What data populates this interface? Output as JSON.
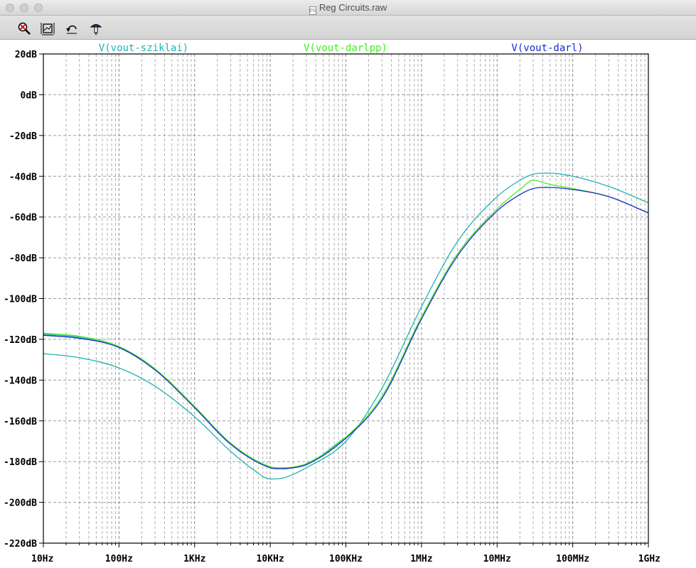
{
  "window": {
    "title": "Reg Circuits.raw",
    "doc_icon_text": "PS"
  },
  "toolbar": {
    "tools": [
      {
        "name": "zoom-tool",
        "icon": "magnifier-x-icon"
      },
      {
        "name": "autorange-tool",
        "icon": "autorange-icon"
      },
      {
        "name": "undo-zoom-tool",
        "icon": "undo-icon"
      },
      {
        "name": "probe-tool",
        "icon": "probe-icon"
      }
    ]
  },
  "chart_data": {
    "type": "line",
    "xscale": "log",
    "xlim": [
      10,
      1000000000
    ],
    "ylim": [
      -220,
      20
    ],
    "yticks": [
      20,
      0,
      -20,
      -40,
      -60,
      -80,
      -100,
      -120,
      -140,
      -160,
      -180,
      -200,
      -220
    ],
    "ytick_labels": [
      "20dB",
      "0dB",
      "-20dB",
      "-40dB",
      "-60dB",
      "-80dB",
      "-100dB",
      "-120dB",
      "-140dB",
      "-160dB",
      "-180dB",
      "-200dB",
      "-220dB"
    ],
    "xticks": [
      10,
      100,
      1000,
      10000,
      100000,
      1000000,
      10000000,
      100000000,
      1000000000
    ],
    "xtick_labels": [
      "10Hz",
      "100Hz",
      "1KHz",
      "10KHz",
      "100KHz",
      "1MHz",
      "10MHz",
      "100MHz",
      "1GHz"
    ],
    "grid": true,
    "series": [
      {
        "name": "V(vout-sziklai)",
        "color": "#22b2b2",
        "x": [
          10,
          30,
          100,
          300,
          1000,
          3000,
          6000,
          10000,
          15000,
          30000,
          100000,
          300000,
          1000000,
          3000000,
          10000000,
          20000000,
          30000000,
          50000000,
          100000000,
          300000000,
          1000000000
        ],
        "y": [
          -127,
          -129,
          -134,
          -143,
          -158,
          -175,
          -184,
          -188.5,
          -188,
          -183,
          -170,
          -144,
          -104,
          -72,
          -50,
          -42,
          -39,
          -38.5,
          -40,
          -45,
          -53
        ]
      },
      {
        "name": "V(vout-sziklai)",
        "color": "#22b2b2",
        "x": [
          10,
          30,
          100,
          300,
          1000,
          3000,
          10000,
          15000,
          20000,
          30000,
          100000
        ],
        "y": [
          -117.5,
          -119,
          -124,
          -135,
          -153,
          -171,
          -182.8,
          -183.2,
          -183,
          -181.5,
          -168
        ]
      },
      {
        "name": "V(vout-darlpp)",
        "color": "#44ee22",
        "x": [
          10,
          30,
          100,
          300,
          1000,
          3000,
          10000,
          15000,
          20000,
          30000,
          100000,
          300000,
          1000000,
          3000000,
          10000000,
          20000000,
          30000000,
          50000000,
          100000000,
          300000000,
          1000000000
        ],
        "y": [
          -117,
          -118.5,
          -123.5,
          -134.5,
          -153,
          -171,
          -182.5,
          -183,
          -182.7,
          -181,
          -168,
          -148,
          -109,
          -78,
          -56,
          -46.5,
          -42,
          -44,
          -46,
          -50,
          -58
        ]
      },
      {
        "name": "V(vout-darl)",
        "color": "#1a2acc",
        "x": [
          10,
          30,
          100,
          300,
          1000,
          3000,
          10000,
          15000,
          20000,
          30000,
          100000,
          300000,
          1000000,
          3000000,
          10000000,
          20000000,
          30000000,
          50000000,
          100000000,
          300000000,
          1000000000
        ],
        "y": [
          -118,
          -119.5,
          -124,
          -135,
          -153.5,
          -171.5,
          -183,
          -183.5,
          -183,
          -181.5,
          -168.5,
          -149,
          -110,
          -79,
          -57,
          -49,
          -46,
          -45.5,
          -46.5,
          -50,
          -58
        ]
      }
    ],
    "legend": [
      {
        "text": "V(vout-sziklai)",
        "color": "#22b2b2"
      },
      {
        "text": "V(vout-darlpp)",
        "color": "#44ee22"
      },
      {
        "text": "V(vout-darl)",
        "color": "#1a2acc"
      }
    ]
  }
}
